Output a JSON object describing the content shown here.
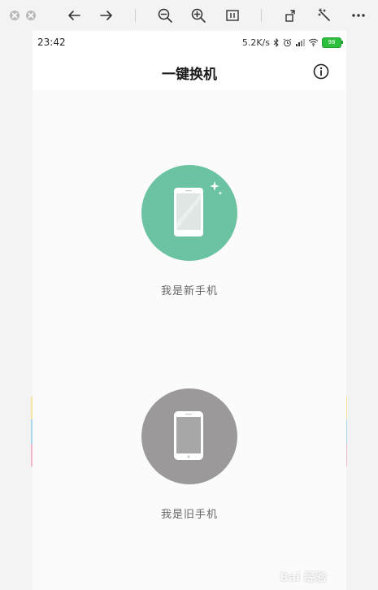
{
  "viewer": {
    "toolbar": [
      "close-window",
      "minimize-window",
      "back",
      "forward",
      "zoom-out",
      "zoom-in",
      "fit-page",
      "rotate",
      "enhance",
      "more"
    ]
  },
  "status_bar": {
    "time": "23:42",
    "net_speed": "5.2K/s",
    "battery": "98",
    "battery_color": "#2fbf3f"
  },
  "app": {
    "title": "一键换机"
  },
  "options": {
    "new_phone": {
      "label": "我是新手机",
      "color": "#6cc3a2"
    },
    "old_phone": {
      "label": "我是旧手机",
      "color": "#9b999a"
    }
  },
  "watermark": "Bai 经验"
}
